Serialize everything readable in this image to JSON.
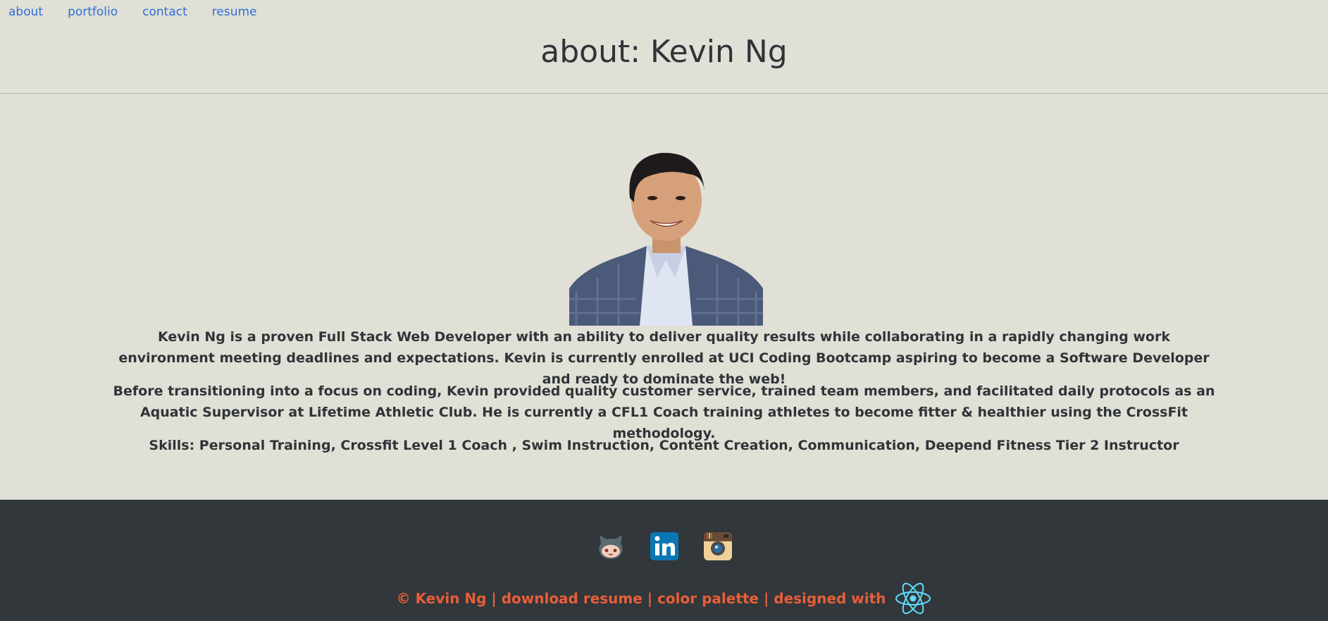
{
  "nav": {
    "items": [
      {
        "label": "about"
      },
      {
        "label": "portfolio"
      },
      {
        "label": "contact"
      },
      {
        "label": "resume"
      }
    ]
  },
  "header": {
    "title": "about: Kevin Ng"
  },
  "about": {
    "paragraph1": "Kevin Ng is a proven Full Stack Web Developer with an ability to deliver quality results while collaborating in a rapidly changing work environment meeting deadlines and expectations. Kevin is currently enrolled at UCI Coding Bootcamp aspiring to become a Software Developer and ready to dominate the web!",
    "paragraph2": "Before transitioning into a focus on coding, Kevin provided quality customer service, trained team members, and facilitated daily protocols as an Aquatic Supervisor at Lifetime Athletic Club. He is currently a CFL1 Coach training athletes to become fitter & healthier using the CrossFit methodology.",
    "skills": "Skills: Personal Training, Crossfit Level 1 Coach , Swim Instruction, Content Creation, Communication, Deepend Fitness Tier 2 Instructor"
  },
  "footer": {
    "icons": [
      "github-icon",
      "linkedin-icon",
      "instagram-icon"
    ],
    "copyright": "© Kevin Ng",
    "separator": "|",
    "download_resume": "download resume",
    "color_palette": "color palette",
    "designed_with": "designed with",
    "logo_icon": "react-icon"
  },
  "colors": {
    "background": "#e0e0d7",
    "text": "#2f3437",
    "nav_link": "#2f6fd6",
    "footer_bg": "#31373a",
    "footer_text": "#e85e3a",
    "react": "#61dafb"
  }
}
